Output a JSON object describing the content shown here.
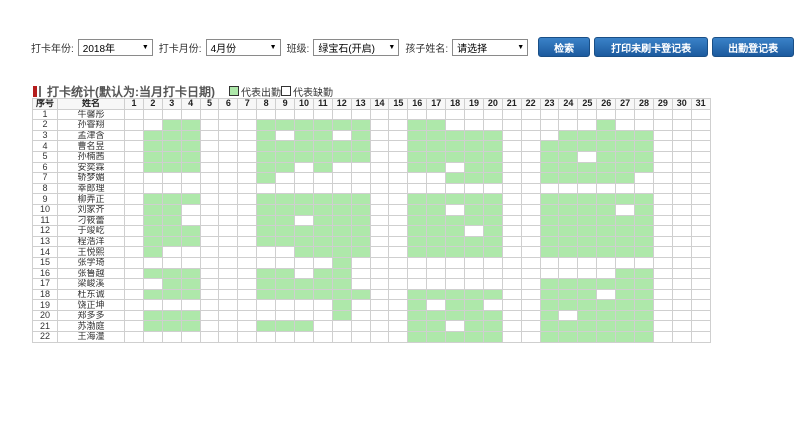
{
  "filters": {
    "year": {
      "label": "打卡年份:",
      "value": "2018年"
    },
    "month": {
      "label": "打卡月份:",
      "value": "4月份"
    },
    "class": {
      "label": "班级:",
      "value": "绿宝石(开启)"
    },
    "child": {
      "label": "孩子姓名:",
      "value": "请选择"
    }
  },
  "buttons": {
    "search": "检索",
    "print_unchecked": "打印未刷卡登记表",
    "attendance_sheet": "出勤登记表"
  },
  "section": {
    "title": "打卡统计(默认为:当月打卡日期)",
    "legend_present": "代表出勤",
    "legend_absent": "代表缺勤"
  },
  "colors": {
    "present": "#aee8aa",
    "absent": "#ffffff",
    "button": "#2a6db0",
    "title_mark": "#b51d1d"
  },
  "table": {
    "headers": {
      "no": "序号",
      "name": "姓名"
    },
    "days": [
      "1",
      "2",
      "3",
      "4",
      "5",
      "6",
      "7",
      "8",
      "9",
      "10",
      "11",
      "12",
      "13",
      "14",
      "15",
      "16",
      "17",
      "18",
      "19",
      "20",
      "21",
      "22",
      "23",
      "24",
      "25",
      "26",
      "27",
      "28",
      "29",
      "30",
      "31"
    ],
    "rows": [
      {
        "no": "1",
        "name": "牛馨彤",
        "present": []
      },
      {
        "no": "2",
        "name": "孙睿翔",
        "present": [
          3,
          4,
          8,
          9,
          10,
          11,
          12,
          13,
          16,
          17,
          26
        ]
      },
      {
        "no": "3",
        "name": "孟津含",
        "present": [
          2,
          3,
          4,
          8,
          10,
          11,
          13,
          16,
          17,
          18,
          19,
          20,
          24,
          25,
          26,
          27,
          28
        ]
      },
      {
        "no": "4",
        "name": "曹名昱",
        "present": [
          2,
          3,
          4,
          8,
          9,
          10,
          11,
          12,
          13,
          16,
          17,
          18,
          19,
          20,
          23,
          24,
          25,
          26,
          27,
          28
        ]
      },
      {
        "no": "5",
        "name": "孙楠茜",
        "present": [
          2,
          3,
          4,
          8,
          9,
          10,
          11,
          12,
          13,
          16,
          17,
          18,
          19,
          20,
          23,
          24,
          26,
          27,
          28
        ]
      },
      {
        "no": "6",
        "name": "安奕霖",
        "present": [
          2,
          3,
          4,
          8,
          9,
          11,
          16,
          17,
          19,
          20,
          23,
          24,
          25,
          26,
          27,
          28
        ]
      },
      {
        "no": "7",
        "name": "轿梦媚",
        "present": [
          8,
          18,
          19,
          20,
          23,
          24,
          25,
          26,
          27
        ]
      },
      {
        "no": "8",
        "name": "幸郎理",
        "present": []
      },
      {
        "no": "9",
        "name": "柳弄正",
        "present": [
          2,
          3,
          4,
          8,
          9,
          10,
          11,
          12,
          13,
          16,
          17,
          18,
          19,
          20,
          23,
          24,
          25,
          26,
          27,
          28
        ]
      },
      {
        "no": "10",
        "name": "刘家齐",
        "present": [
          2,
          3,
          8,
          9,
          10,
          11,
          12,
          13,
          16,
          17,
          19,
          20,
          23,
          24,
          25,
          26,
          28
        ]
      },
      {
        "no": "11",
        "name": "刁筱蕾",
        "present": [
          2,
          3,
          8,
          9,
          11,
          12,
          13,
          16,
          17,
          18,
          19,
          20,
          23,
          24,
          25,
          26,
          27,
          28
        ]
      },
      {
        "no": "12",
        "name": "于竣屹",
        "present": [
          2,
          3,
          4,
          8,
          9,
          10,
          11,
          12,
          13,
          16,
          17,
          18,
          20,
          23,
          24,
          25,
          26,
          27,
          28
        ]
      },
      {
        "no": "13",
        "name": "程浩洋",
        "present": [
          2,
          3,
          4,
          8,
          9,
          10,
          11,
          12,
          13,
          16,
          17,
          18,
          19,
          20,
          23,
          24,
          25,
          26,
          27,
          28
        ]
      },
      {
        "no": "14",
        "name": "王悦熙",
        "present": [
          2,
          10,
          11,
          12,
          13,
          16,
          17,
          18,
          19,
          20,
          23,
          24,
          25,
          26,
          27,
          28
        ]
      },
      {
        "no": "15",
        "name": "张学琦",
        "present": [
          12
        ]
      },
      {
        "no": "16",
        "name": "张鲁越",
        "present": [
          2,
          3,
          4,
          8,
          9,
          11,
          12,
          27,
          28
        ]
      },
      {
        "no": "17",
        "name": "梁峻溪",
        "present": [
          3,
          4,
          8,
          9,
          10,
          11,
          12,
          23,
          24,
          25,
          26,
          27,
          28
        ]
      },
      {
        "no": "18",
        "name": "杜东诚",
        "present": [
          2,
          3,
          4,
          8,
          9,
          10,
          11,
          12,
          13,
          16,
          17,
          18,
          19,
          20,
          23,
          24,
          25,
          27,
          28
        ]
      },
      {
        "no": "19",
        "name": "饶正坤",
        "present": [
          12,
          16,
          18,
          19,
          23,
          24,
          25,
          26,
          27,
          28
        ]
      },
      {
        "no": "20",
        "name": "郑多多",
        "present": [
          2,
          3,
          4,
          12,
          16,
          17,
          18,
          19,
          20,
          23,
          25,
          26,
          27,
          28
        ]
      },
      {
        "no": "21",
        "name": "苏渤庭",
        "present": [
          2,
          3,
          4,
          8,
          9,
          10,
          16,
          17,
          19,
          20,
          23,
          24,
          25,
          26,
          27,
          28
        ]
      },
      {
        "no": "22",
        "name": "王海潼",
        "present": [
          16,
          17,
          18,
          19,
          20,
          23,
          24,
          25,
          26,
          27,
          28
        ]
      }
    ]
  }
}
